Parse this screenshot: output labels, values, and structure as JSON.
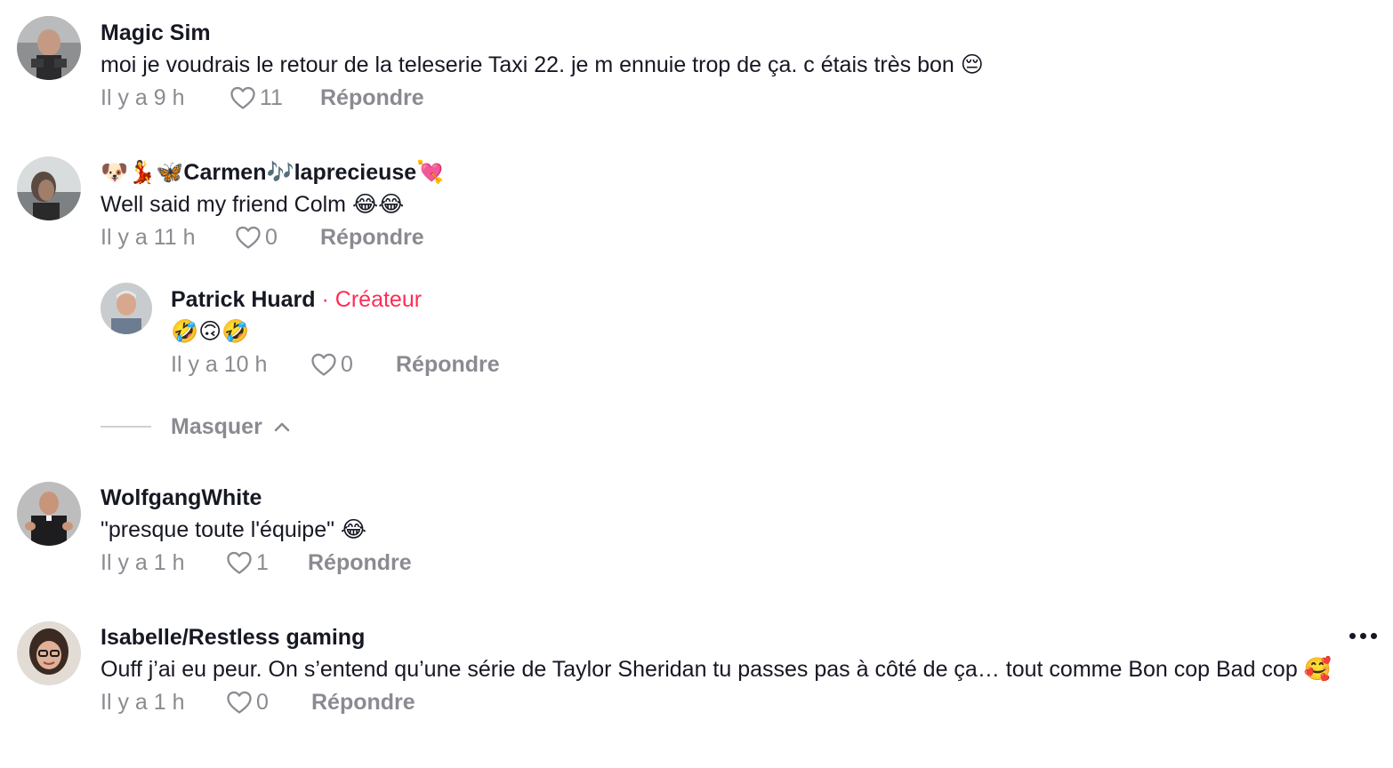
{
  "comments": [
    {
      "username": "Magic Sim",
      "text": "moi je voudrais le retour de la teleserie Taxi 22. je m ennuie trop de ça. c étais très bon 😔",
      "time": "Il y a 9 h",
      "likes": "11",
      "reply_label": "Répondre"
    },
    {
      "username": "🐶💃🦋Carmen🎶laprecieuse💘",
      "text": "Well said my friend Colm 😂😂",
      "time": "Il y a 11 h",
      "likes": "0",
      "reply_label": "Répondre"
    },
    {
      "username": "Patrick Huard",
      "creator_dot": " · ",
      "creator_label": "Créateur",
      "text": "🤣🙃🤣",
      "time": "Il y a 10 h",
      "likes": "0",
      "reply_label": "Répondre"
    },
    {
      "username": "WolfgangWhite",
      "text": "\"presque toute l'équipe\" 😂",
      "time": "Il y a 1 h",
      "likes": "1",
      "reply_label": "Répondre"
    },
    {
      "username": "Isabelle/Restless gaming",
      "text": "Ouff j’ai eu peur. On s’entend qu’une série de Taylor Sheridan tu passes pas à côté de ça… tout comme Bon cop Bad cop 🥰",
      "time": "Il y a 1 h",
      "likes": "0",
      "reply_label": "Répondre"
    }
  ],
  "hide_replies_label": "Masquer",
  "icons": {
    "like": "heart-outline-icon",
    "hide": "chevron-up-icon",
    "more": "more-dots-icon"
  },
  "colors": {
    "accent": "#fe2c55",
    "secondary_text": "#8a8b91",
    "primary_text": "#161823"
  }
}
